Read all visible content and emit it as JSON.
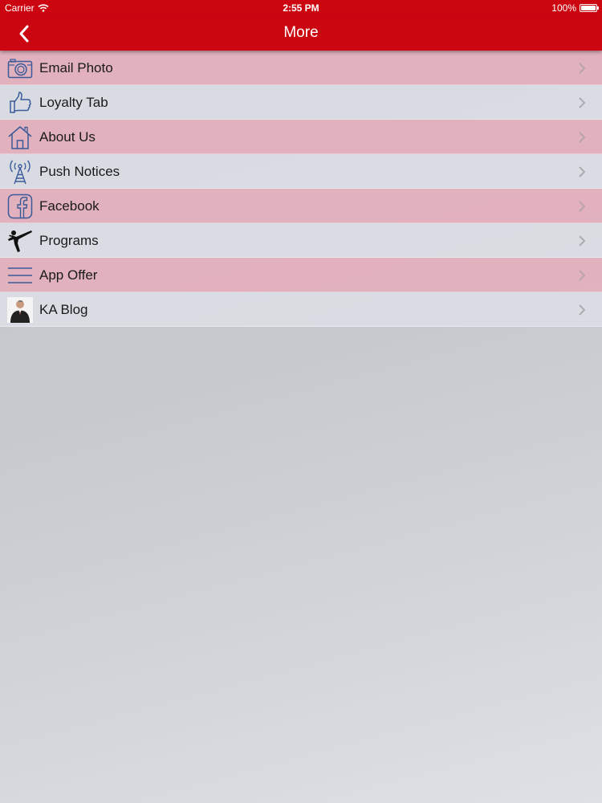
{
  "status_bar": {
    "carrier": "Carrier",
    "time": "2:55 PM",
    "battery": "100%",
    "battery_level": 1.0
  },
  "nav": {
    "title": "More",
    "back_icon": "chevron-left-icon"
  },
  "colors": {
    "brand_red": "#cc0611",
    "row_pink": "#e9aab8",
    "row_gray": "#dde1e6",
    "icon_blue": "#3b5a9a"
  },
  "menu": {
    "items": [
      {
        "label": "Email Photo",
        "icon": "camera-icon"
      },
      {
        "label": "Loyalty Tab",
        "icon": "thumbs-up-icon"
      },
      {
        "label": "About Us",
        "icon": "house-icon"
      },
      {
        "label": "Push Notices",
        "icon": "antenna-icon"
      },
      {
        "label": "Facebook",
        "icon": "facebook-icon"
      },
      {
        "label": "Programs",
        "icon": "martial-arts-kick-icon"
      },
      {
        "label": "App Offer",
        "icon": "menu-lines-icon"
      },
      {
        "label": "KA Blog",
        "icon": "person-photo-icon"
      }
    ]
  }
}
